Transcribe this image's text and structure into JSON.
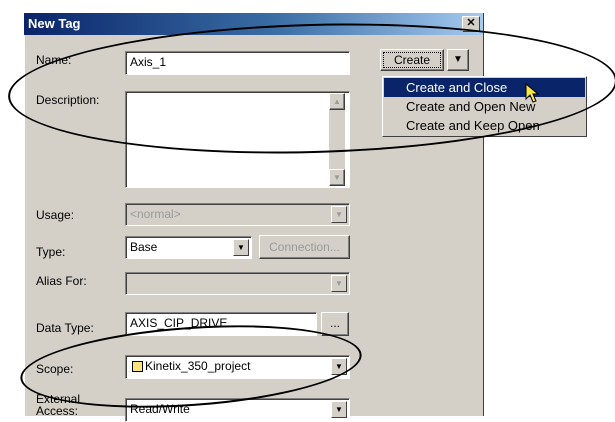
{
  "dialog": {
    "title": "New Tag",
    "close_glyph": "✕"
  },
  "form": {
    "name_label": "Name:",
    "name_value": "Axis_1",
    "description_label": "Description:",
    "description_value": "",
    "usage_label": "Usage:",
    "usage_value": "<normal>",
    "type_label": "Type:",
    "type_value": "Base",
    "connection_button": "Connection...",
    "alias_label": "Alias For:",
    "alias_value": "",
    "datatype_label": "Data Type:",
    "datatype_value": "AXIS_CIP_DRIVE",
    "browse_button": "...",
    "scope_label": "Scope:",
    "scope_value": "Kinetix_350_project",
    "external_label_1": "External",
    "external_label_2": "Access:",
    "external_value": "Read/Write"
  },
  "create": {
    "label": "Create",
    "menu": [
      "Create and Close",
      "Create and Open New",
      "Create and Keep Open"
    ]
  }
}
